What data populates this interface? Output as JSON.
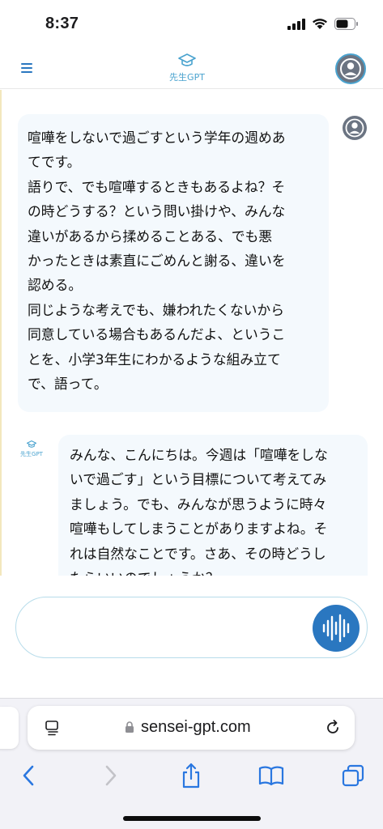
{
  "status_bar": {
    "time": "8:37"
  },
  "header": {
    "logo_text": "先生GPT"
  },
  "chat": {
    "user_message_lines": [
      "喧嘩をしないで過ごすという学年の週めあ",
      "てです。",
      "語りで、でも喧嘩するときもあるよね？そ",
      "の時どうする？という問い掛けや、みんな",
      "違いがあるから揉めることある、でも悪",
      "かったときは素直にごめんと謝る、違いを",
      "認める。",
      "同じような考えでも、嫌われたくないから",
      "同意している場合もあるんだよ、というこ",
      "とを、小学3年生にわかるような組み立て",
      "で、語って。"
    ],
    "assistant_logo_text": "先生GPT",
    "assistant_message_lines": [
      "みんな、こんにちは。今週は「喧嘩をしな",
      "いで過ごす」という目標について考えてみ",
      "ましょう。でも、みんなが思うように時々",
      "喧嘩もしてしまうことがありますよね。そ",
      "れは自然なことです。さあ、その時どうし",
      "たらいいのでしょうか？"
    ]
  },
  "composer": {
    "input_value": ""
  },
  "browser": {
    "url": "sensei-gpt.com"
  },
  "colors": {
    "brand": "#4aa3cf",
    "voice_button": "#2a77c0",
    "bubble_bg": "#f4f9fd",
    "link_blue": "#2a77e0"
  }
}
